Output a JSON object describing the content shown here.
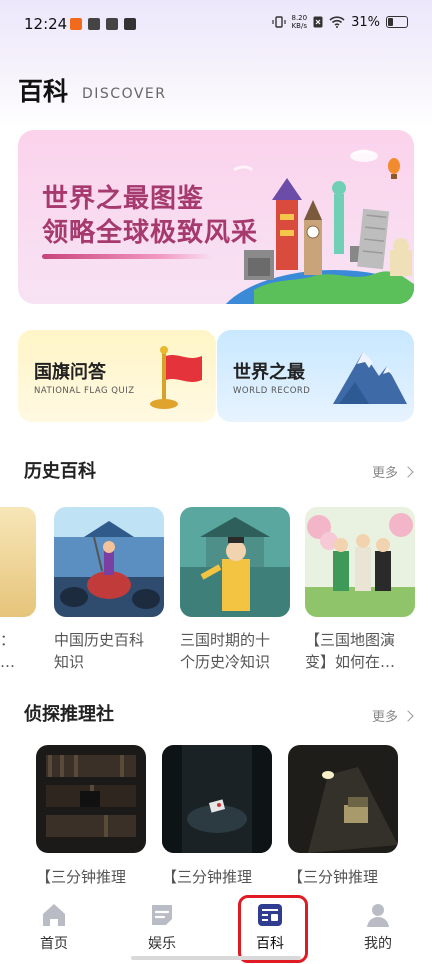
{
  "status_bar": {
    "time": "12:24",
    "net_speed_value": "8.20",
    "net_speed_unit": "KB/s",
    "battery": "31%"
  },
  "header": {
    "title": "百科",
    "subtitle": "DISCOVER"
  },
  "banner": {
    "line1": "世界之最图鉴",
    "line2": "领略全球极致风采"
  },
  "tiles": [
    {
      "title": "国旗问答",
      "subtitle": "NATIONAL FLAG QUIZ"
    },
    {
      "title": "世界之最",
      "subtitle": "WORLD RECORD"
    }
  ],
  "history": {
    "title": "历史百科",
    "more": "更多",
    "cards": [
      {
        "caption_l1": "：",
        "caption_l2": "…"
      },
      {
        "caption_l1": "中国历史百科",
        "caption_l2": "知识"
      },
      {
        "caption_l1": "三国时期的十",
        "caption_l2": "个历史冷知识"
      },
      {
        "caption_l1": "【三国地图演",
        "caption_l2": "变】如何在…"
      }
    ]
  },
  "detective": {
    "title": "侦探推理社",
    "more": "更多",
    "cards": [
      {
        "caption": "【三分钟推理"
      },
      {
        "caption": "【三分钟推理"
      },
      {
        "caption": "【三分钟推理"
      }
    ]
  },
  "nav": {
    "items": [
      {
        "label": "首页",
        "icon": "home-icon"
      },
      {
        "label": "娱乐",
        "icon": "entertainment-icon"
      },
      {
        "label": "百科",
        "icon": "encyclopedia-icon",
        "active": true
      },
      {
        "label": "我的",
        "icon": "profile-icon"
      }
    ]
  },
  "colors": {
    "accent": "#2f3c8f",
    "banner_text": "#a6396e",
    "highlight": "#e01b24"
  }
}
